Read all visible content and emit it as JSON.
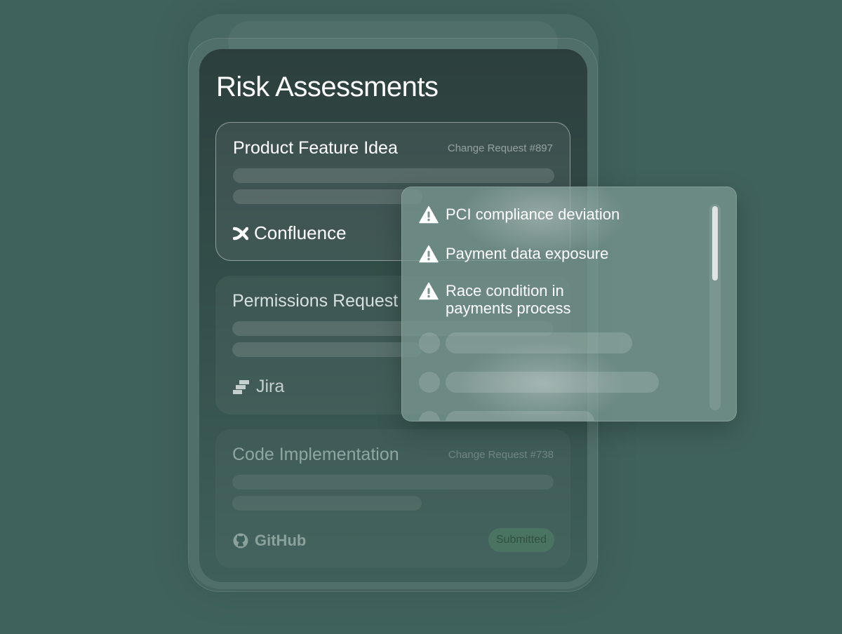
{
  "page": {
    "title": "Risk Assessments"
  },
  "cards": [
    {
      "title": "Product Feature Idea",
      "reference": "Change Request #897",
      "source": "Confluence",
      "source_icon": "confluence-icon"
    },
    {
      "title": "Permissions Request",
      "source": "Jira",
      "source_icon": "jira-icon"
    },
    {
      "title": "Code Implementation",
      "reference": "Change Request #738",
      "source": "GitHub",
      "source_icon": "github-icon",
      "status": "Submitted"
    }
  ],
  "risks": {
    "icon": "warning-icon",
    "items": [
      {
        "label": "PCI compliance deviation"
      },
      {
        "label": "Payment data exposure"
      },
      {
        "label": "Race condition in payments process"
      }
    ]
  },
  "colors": {
    "background": "#40625d",
    "panel": "#2c3f3d",
    "status_badge": "#4a7461",
    "text": "#ffffff"
  }
}
